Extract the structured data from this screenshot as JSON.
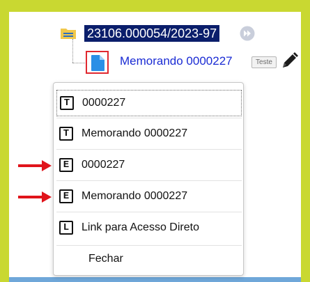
{
  "tree": {
    "process_number": "23106.000054/2023-97",
    "document_link": "Memorando 0000227",
    "badge": "Teste",
    "icons": {
      "folder": "folder-icon",
      "forward": "forward-circle-icon",
      "document": "document-icon",
      "pen": "pen-icon"
    }
  },
  "menu": {
    "items": [
      {
        "key": "T",
        "label": "0000227",
        "focused": true
      },
      {
        "key": "T",
        "label": "Memorando 0000227"
      },
      {
        "key": "E",
        "label": "0000227",
        "highlighted_by_arrow": true
      },
      {
        "key": "E",
        "label": "Memorando 0000227",
        "highlighted_by_arrow": true
      },
      {
        "key": "L",
        "label": "Link para Acesso Direto"
      }
    ],
    "close_label": "Fechar"
  },
  "colors": {
    "outer_background": "#c9d831",
    "selection_background": "#0a1e6b",
    "link_blue": "#1a2bd4",
    "document_icon_blue": "#2a8fe6",
    "folder_yellow": "#f1c84b",
    "document_box_border": "#e0282f",
    "arrow_red": "#e0141b",
    "bottom_rule": "#6fa7d9"
  }
}
